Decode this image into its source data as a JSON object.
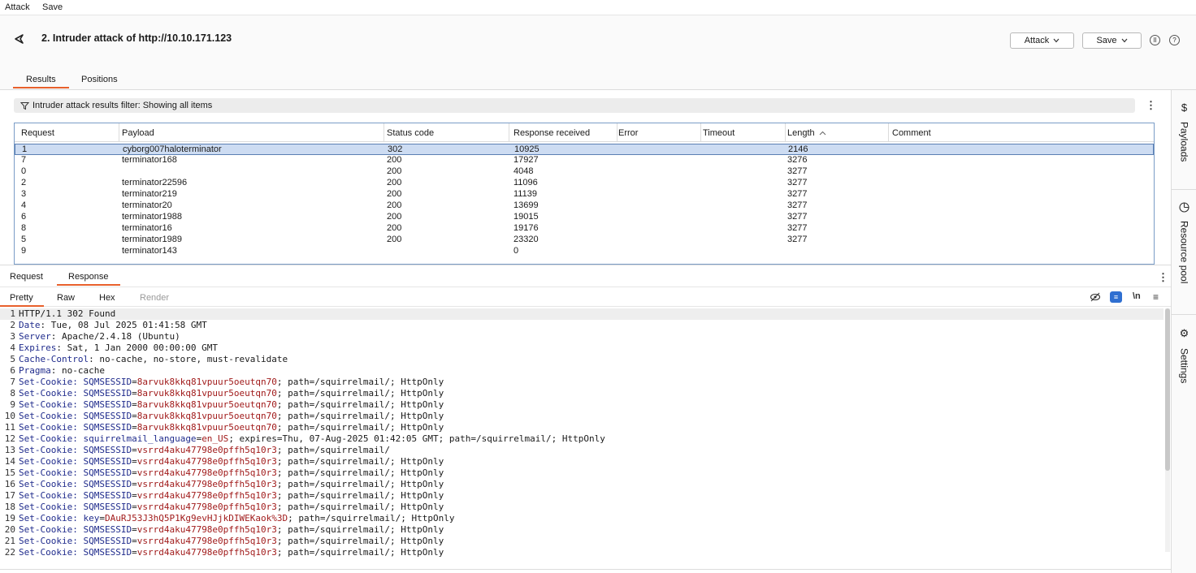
{
  "menubar": {
    "attack": "Attack",
    "save": "Save"
  },
  "header": {
    "title": "2. Intruder attack of http://10.10.171.123",
    "attack_btn": "Attack",
    "save_btn": "Save",
    "pause_icon": "pause-icon",
    "help_icon": "help-icon"
  },
  "tabs": {
    "results": "Results",
    "positions": "Positions"
  },
  "filter": {
    "text": "Intruder attack results filter: Showing all items"
  },
  "table": {
    "headers": {
      "request": "Request",
      "payload": "Payload",
      "status": "Status code",
      "response": "Response received",
      "error": "Error",
      "timeout": "Timeout",
      "length": "Length",
      "comment": "Comment"
    },
    "rows": [
      {
        "request": "1",
        "payload": "cyborg007haloterminator",
        "status": "302",
        "response": "10925",
        "length": "2146"
      },
      {
        "request": "7",
        "payload": "terminator168",
        "status": "200",
        "response": "17927",
        "length": "3276"
      },
      {
        "request": "0",
        "payload": "",
        "status": "200",
        "response": "4048",
        "length": "3277"
      },
      {
        "request": "2",
        "payload": "terminator22596",
        "status": "200",
        "response": "11096",
        "length": "3277"
      },
      {
        "request": "3",
        "payload": "terminator219",
        "status": "200",
        "response": "11139",
        "length": "3277"
      },
      {
        "request": "4",
        "payload": "terminator20",
        "status": "200",
        "response": "13699",
        "length": "3277"
      },
      {
        "request": "6",
        "payload": "terminator1988",
        "status": "200",
        "response": "19015",
        "length": "3277"
      },
      {
        "request": "8",
        "payload": "terminator16",
        "status": "200",
        "response": "19176",
        "length": "3277"
      },
      {
        "request": "5",
        "payload": "terminator1989",
        "status": "200",
        "response": "23320",
        "length": "3277"
      },
      {
        "request": "9",
        "payload": "terminator143",
        "status": "",
        "response": "0",
        "length": ""
      }
    ]
  },
  "rr_tabs": {
    "request": "Request",
    "response": "Response"
  },
  "view_tabs": {
    "pretty": "Pretty",
    "raw": "Raw",
    "hex": "Hex",
    "render": "Render",
    "newline": "\\n"
  },
  "response_lines": [
    {
      "n": "1",
      "k": "",
      "v": "HTTP/1.1 302 Found"
    },
    {
      "n": "2",
      "k": "Date",
      "v": ": Tue, 08 Jul 2025 01:41:58 GMT"
    },
    {
      "n": "3",
      "k": "Server",
      "v": ": Apache/2.4.18 (Ubuntu)"
    },
    {
      "n": "4",
      "k": "Expires",
      "v": ": Sat, 1 Jan 2000 00:00:00 GMT"
    },
    {
      "n": "5",
      "k": "Cache-Control",
      "v": ": no-cache, no-store, must-revalidate"
    },
    {
      "n": "6",
      "k": "Pragma",
      "v": ": no-cache"
    },
    {
      "n": "7",
      "k": "Set-Cookie: ",
      "c": "SQMSESSID",
      "cv": "8arvuk8kkq81vpuur5oeutqn70",
      "r": "; path=/squirrelmail/; HttpOnly"
    },
    {
      "n": "8",
      "k": "Set-Cookie: ",
      "c": "SQMSESSID",
      "cv": "8arvuk8kkq81vpuur5oeutqn70",
      "r": "; path=/squirrelmail/; HttpOnly"
    },
    {
      "n": "9",
      "k": "Set-Cookie: ",
      "c": "SQMSESSID",
      "cv": "8arvuk8kkq81vpuur5oeutqn70",
      "r": "; path=/squirrelmail/; HttpOnly"
    },
    {
      "n": "10",
      "k": "Set-Cookie: ",
      "c": "SQMSESSID",
      "cv": "8arvuk8kkq81vpuur5oeutqn70",
      "r": "; path=/squirrelmail/; HttpOnly"
    },
    {
      "n": "11",
      "k": "Set-Cookie: ",
      "c": "SQMSESSID",
      "cv": "8arvuk8kkq81vpuur5oeutqn70",
      "r": "; path=/squirrelmail/; HttpOnly"
    },
    {
      "n": "12",
      "k": "Set-Cookie: ",
      "c": "squirrelmail_language",
      "cv": "en_US",
      "r": "; expires=Thu, 07-Aug-2025 01:42:05 GMT; path=/squirrelmail/; HttpOnly"
    },
    {
      "n": "13",
      "k": "Set-Cookie: ",
      "c": "SQMSESSID",
      "cv": "vsrrd4aku47798e0pffh5q10r3",
      "r": "; path=/squirrelmail/"
    },
    {
      "n": "14",
      "k": "Set-Cookie: ",
      "c": "SQMSESSID",
      "cv": "vsrrd4aku47798e0pffh5q10r3",
      "r": "; path=/squirrelmail/; HttpOnly"
    },
    {
      "n": "15",
      "k": "Set-Cookie: ",
      "c": "SQMSESSID",
      "cv": "vsrrd4aku47798e0pffh5q10r3",
      "r": "; path=/squirrelmail/; HttpOnly"
    },
    {
      "n": "16",
      "k": "Set-Cookie: ",
      "c": "SQMSESSID",
      "cv": "vsrrd4aku47798e0pffh5q10r3",
      "r": "; path=/squirrelmail/; HttpOnly"
    },
    {
      "n": "17",
      "k": "Set-Cookie: ",
      "c": "SQMSESSID",
      "cv": "vsrrd4aku47798e0pffh5q10r3",
      "r": "; path=/squirrelmail/; HttpOnly"
    },
    {
      "n": "18",
      "k": "Set-Cookie: ",
      "c": "SQMSESSID",
      "cv": "vsrrd4aku47798e0pffh5q10r3",
      "r": "; path=/squirrelmail/; HttpOnly"
    },
    {
      "n": "19",
      "k": "Set-Cookie: ",
      "c": "key",
      "cv": "DAuRJ53J3hQ5P1Kg9evHJjkDIWEKaok%3D",
      "r": "; path=/squirrelmail/; HttpOnly"
    },
    {
      "n": "20",
      "k": "Set-Cookie: ",
      "c": "SQMSESSID",
      "cv": "vsrrd4aku47798e0pffh5q10r3",
      "r": "; path=/squirrelmail/; HttpOnly"
    },
    {
      "n": "21",
      "k": "Set-Cookie: ",
      "c": "SQMSESSID",
      "cv": "vsrrd4aku47798e0pffh5q10r3",
      "r": "; path=/squirrelmail/; HttpOnly"
    },
    {
      "n": "22",
      "k": "Set-Cookie: ",
      "c": "SQMSESSID",
      "cv": "vsrrd4aku47798e0pffh5q10r3",
      "r": "; path=/squirrelmail/; HttpOnly"
    }
  ],
  "sidebar": {
    "payloads": "Payloads",
    "resource_pool": "Resource pool",
    "settings": "Settings"
  },
  "colors": {
    "accent": "#e8602c",
    "selection": "#cddcf2",
    "header_key": "#1f2b8c",
    "cookie_value": "#a11b1b"
  }
}
